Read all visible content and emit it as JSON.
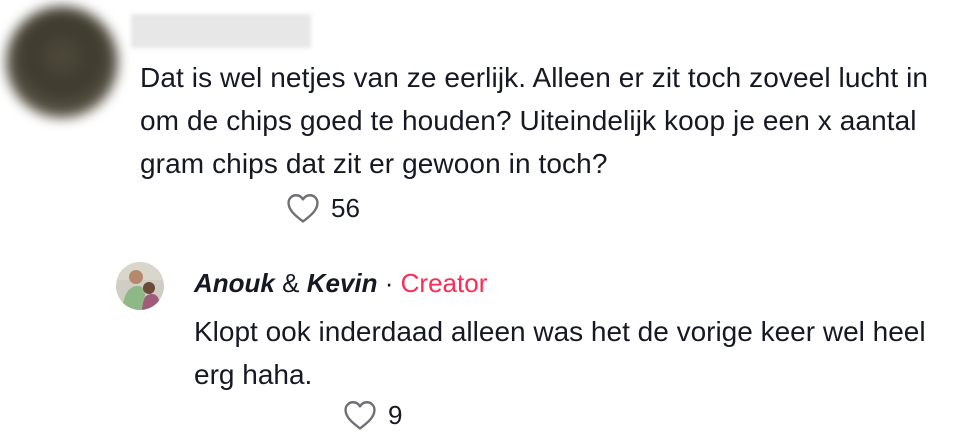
{
  "comment": {
    "text": "Dat is wel netjes van ze eerlijk. Alleen er zit toch zoveel lucht in om de chips goed te houden? Uiteindelijk koop je een x aantal gram chips dat zit er gewoon in toch?",
    "like_icon": "heart-outline-icon",
    "likes": "56"
  },
  "reply": {
    "author_first": "Anouk",
    "author_amp": "&",
    "author_second": "Kevin",
    "separator": "·",
    "badge": "Creator",
    "badge_color": "#fe2c55",
    "text": "Klopt ook inderdaad alleen was het de vorige keer wel heel erg haha.",
    "like_icon": "heart-outline-icon",
    "likes": "9"
  }
}
